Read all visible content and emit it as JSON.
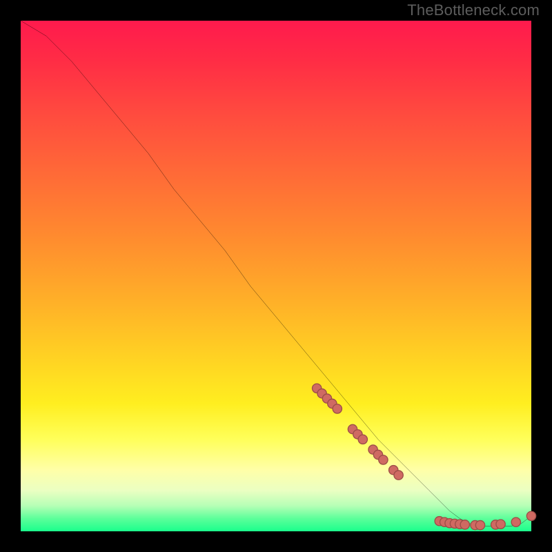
{
  "attribution": "TheBottleneck.com",
  "colors": {
    "page_bg": "#000000",
    "curve": "#000000",
    "marker_fill": "#cf6a62",
    "marker_stroke": "#9c4d47",
    "attribution_text": "#5d5d5d"
  },
  "chart_data": {
    "type": "line",
    "title": "",
    "xlabel": "",
    "ylabel": "",
    "xlim": [
      0,
      100
    ],
    "ylim": [
      0,
      100
    ],
    "grid": false,
    "legend": false,
    "series": [
      {
        "name": "curve",
        "x": [
          0,
          5,
          10,
          15,
          20,
          25,
          30,
          35,
          40,
          45,
          50,
          55,
          60,
          65,
          70,
          75,
          80,
          82,
          84,
          86,
          88,
          90,
          92,
          94,
          96,
          98,
          100
        ],
        "y": [
          100,
          97,
          92,
          86,
          80,
          74,
          67,
          61,
          55,
          48,
          42,
          36,
          30,
          24,
          18,
          13,
          8,
          6,
          4,
          2.5,
          1.5,
          1,
          1,
          1,
          1,
          1.5,
          3
        ]
      }
    ],
    "markers": [
      {
        "x": 58,
        "y": 28
      },
      {
        "x": 59,
        "y": 27
      },
      {
        "x": 60,
        "y": 26
      },
      {
        "x": 61,
        "y": 25
      },
      {
        "x": 62,
        "y": 24
      },
      {
        "x": 65,
        "y": 20
      },
      {
        "x": 66,
        "y": 19
      },
      {
        "x": 67,
        "y": 18
      },
      {
        "x": 69,
        "y": 16
      },
      {
        "x": 70,
        "y": 15
      },
      {
        "x": 71,
        "y": 14
      },
      {
        "x": 73,
        "y": 12
      },
      {
        "x": 74,
        "y": 11
      },
      {
        "x": 82,
        "y": 2
      },
      {
        "x": 83,
        "y": 1.8
      },
      {
        "x": 84,
        "y": 1.6
      },
      {
        "x": 85,
        "y": 1.5
      },
      {
        "x": 86,
        "y": 1.4
      },
      {
        "x": 87,
        "y": 1.3
      },
      {
        "x": 89,
        "y": 1.2
      },
      {
        "x": 90,
        "y": 1.2
      },
      {
        "x": 93,
        "y": 1.3
      },
      {
        "x": 94,
        "y": 1.4
      },
      {
        "x": 97,
        "y": 1.8
      },
      {
        "x": 100,
        "y": 3
      }
    ]
  }
}
